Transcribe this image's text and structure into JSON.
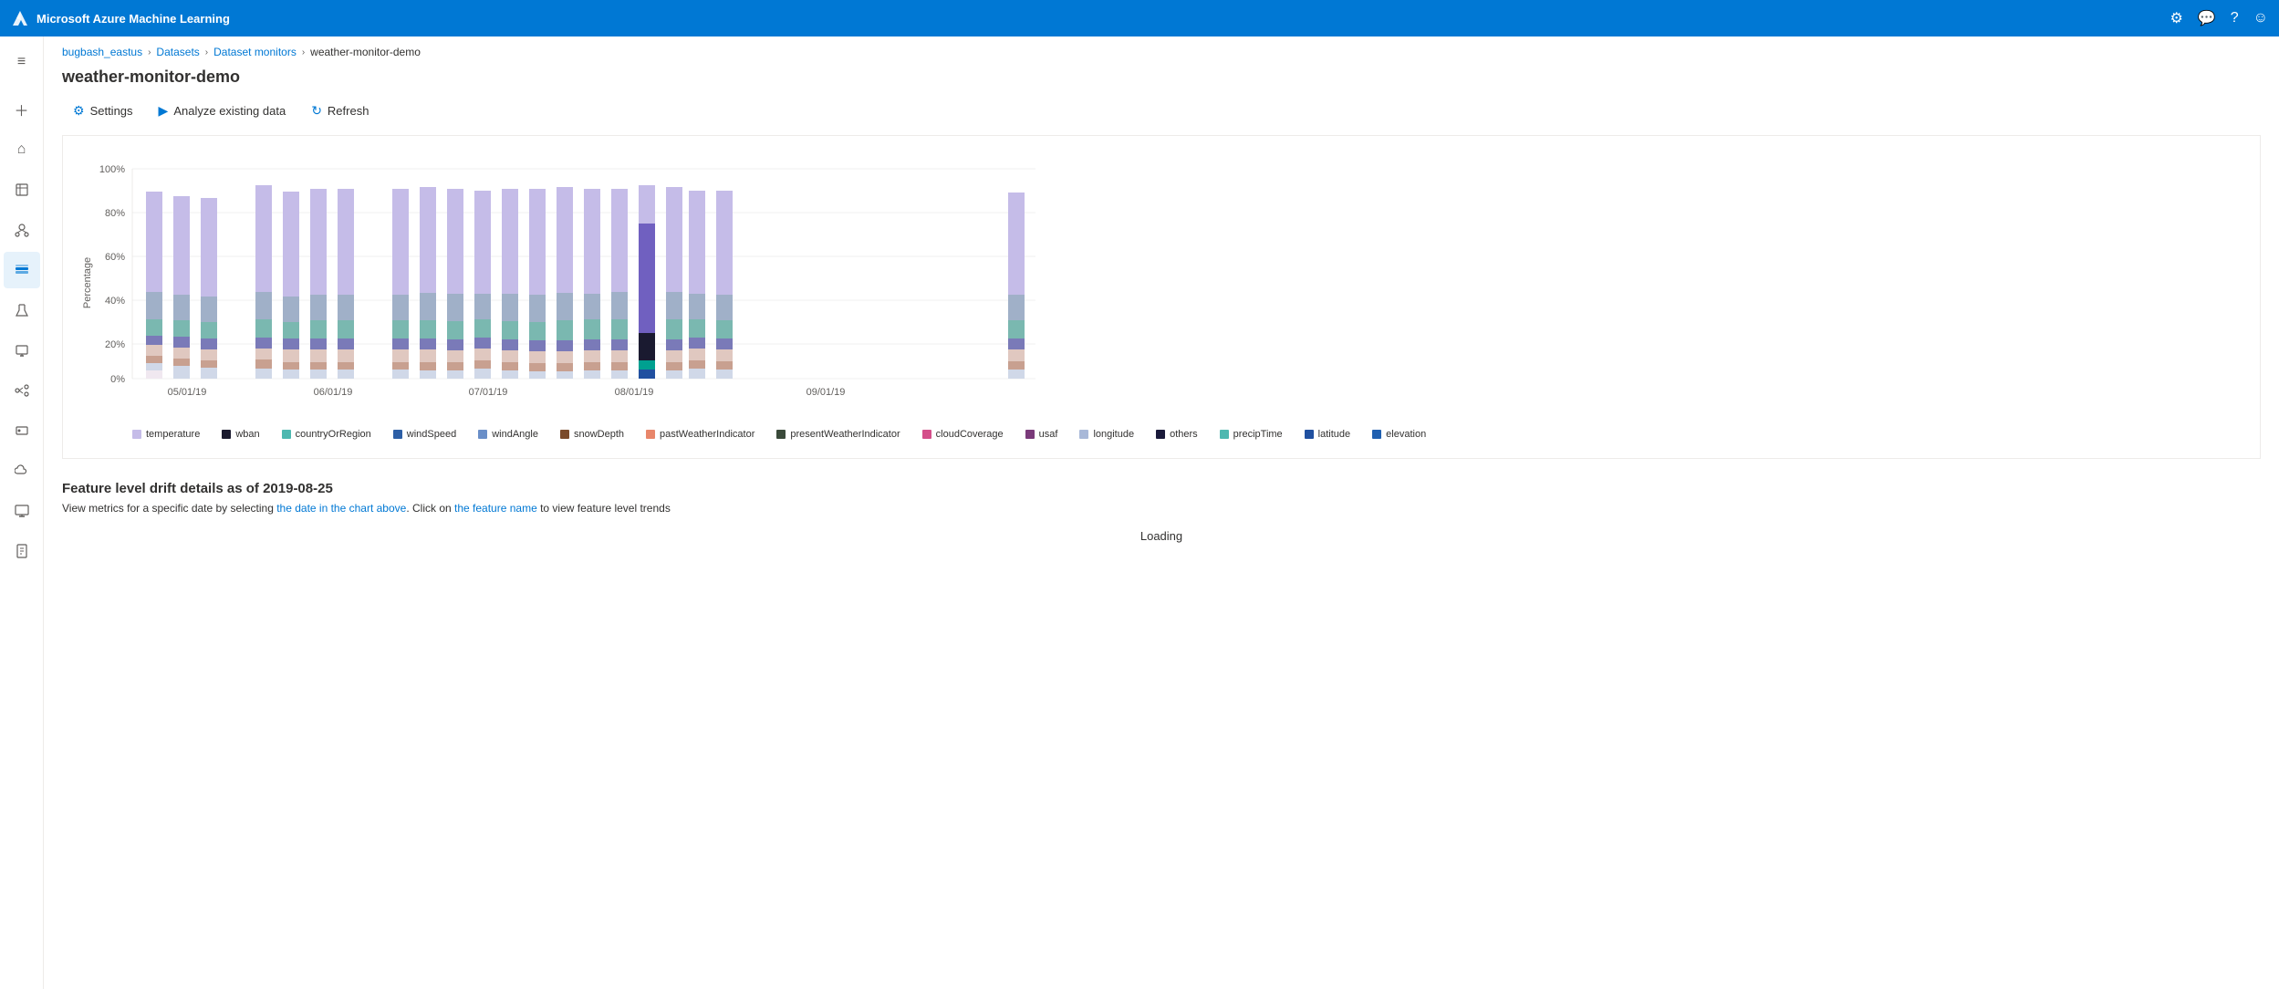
{
  "app": {
    "title": "Microsoft Azure Machine Learning"
  },
  "topbar": {
    "title": "Microsoft Azure Machine Learning",
    "icons": [
      "settings",
      "feedback",
      "help",
      "account"
    ]
  },
  "breadcrumb": {
    "items": [
      "bugbash_eastus",
      "Datasets",
      "Dataset monitors"
    ],
    "current": "weather-monitor-demo"
  },
  "page": {
    "title": "weather-monitor-demo"
  },
  "toolbar": {
    "settings_label": "Settings",
    "analyze_label": "Analyze existing data",
    "refresh_label": "Refresh"
  },
  "chart": {
    "y_labels": [
      "100%",
      "80%",
      "60%",
      "40%",
      "20%",
      "0%"
    ],
    "x_labels": [
      "05/01/19",
      "06/01/19",
      "07/01/19",
      "08/01/19",
      "09/01/19"
    ],
    "y_axis_label": "Percentage"
  },
  "legend": {
    "items": [
      {
        "label": "temperature",
        "color": "#c5bce8"
      },
      {
        "label": "wban",
        "color": "#1a1a2e"
      },
      {
        "label": "countryOrRegion",
        "color": "#4db8b0"
      },
      {
        "label": "windSpeed",
        "color": "#2d5fa6"
      },
      {
        "label": "windAngle",
        "color": "#6a8fc8"
      },
      {
        "label": "snowDepth",
        "color": "#7a4a2a"
      },
      {
        "label": "pastWeatherIndicator",
        "color": "#e8866a"
      },
      {
        "label": "presentWeatherIndicator",
        "color": "#3a4a3a"
      },
      {
        "label": "cloudCoverage",
        "color": "#d44f8a"
      },
      {
        "label": "usaf",
        "color": "#7a3a7a"
      },
      {
        "label": "longitude",
        "color": "#a8b8d8"
      },
      {
        "label": "others",
        "color": "#1a1a3a"
      },
      {
        "label": "precipTime",
        "color": "#4db8b0"
      },
      {
        "label": "latitude",
        "color": "#2050a0"
      },
      {
        "label": "elevation",
        "color": "#2060b0"
      }
    ]
  },
  "drift_section": {
    "title": "Feature level drift details as of 2019-08-25",
    "subtitle_pre": "View metrics for a specific date by selecting ",
    "subtitle_link1": "the date in the chart above",
    "subtitle_mid": ". Click on ",
    "subtitle_link2": "the feature name",
    "subtitle_post": " to view feature level trends",
    "loading": "Loading"
  },
  "sidebar": {
    "items": [
      {
        "name": "menu",
        "icon": "≡"
      },
      {
        "name": "home",
        "icon": "⌂"
      },
      {
        "name": "favorites",
        "icon": "★"
      },
      {
        "name": "models",
        "icon": "◫"
      },
      {
        "name": "datasets",
        "icon": "⊞",
        "active": true
      },
      {
        "name": "experiments",
        "icon": "⚗"
      },
      {
        "name": "compute",
        "icon": "⬡"
      },
      {
        "name": "pipelines",
        "icon": "⬢"
      },
      {
        "name": "endpoints",
        "icon": "◈"
      },
      {
        "name": "cloud",
        "icon": "☁"
      },
      {
        "name": "monitor",
        "icon": "⊡"
      },
      {
        "name": "audit",
        "icon": "⊟"
      },
      {
        "name": "plus",
        "icon": "＋",
        "top": true
      }
    ]
  }
}
